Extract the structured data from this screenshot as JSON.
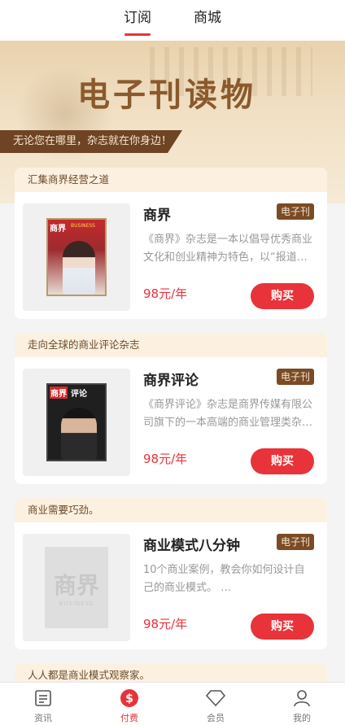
{
  "header": {
    "tabs": [
      {
        "label": "订阅",
        "active": true
      },
      {
        "label": "商城",
        "active": false
      }
    ]
  },
  "banner": {
    "title": "电子刊读物",
    "subtitle": "无论您在哪里，杂志就在你身边！"
  },
  "products": [
    {
      "slogan": "汇集商界经营之道",
      "name": "商界",
      "badge": "电子刊",
      "description": "《商界》杂志是一本以倡导优秀商业文化和创业精神为特色，以“报道…",
      "price": "98元/年",
      "buy_label": "购买",
      "cover": {
        "logo": "商界",
        "sub": "BUSINESS"
      }
    },
    {
      "slogan": "走向全球的商业评论杂志",
      "name": "商界评论",
      "badge": "电子刊",
      "description": "《商界评论》杂志是商界传媒有限公司旗下的一本高端的商业管理类杂…",
      "price": "98元/年",
      "buy_label": "购买",
      "cover": {
        "logo": "商界",
        "sub": "评论"
      }
    },
    {
      "slogan": "商业需要巧劲。",
      "name": "商业模式八分钟",
      "badge": "电子刊",
      "description": "10个商业案例，教会你如何设计自己的商业模式。 …",
      "price": "98元/年",
      "buy_label": "购买",
      "cover": {
        "logo": "商界",
        "sub": "BUSINESS"
      }
    },
    {
      "slogan": "人人都是商业模式观察家。"
    }
  ],
  "tabbar": [
    {
      "label": "资讯",
      "icon": "news-icon",
      "active": false
    },
    {
      "label": "付费",
      "icon": "paid-icon",
      "active": true
    },
    {
      "label": "会员",
      "icon": "diamond-icon",
      "active": false
    },
    {
      "label": "我的",
      "icon": "user-icon",
      "active": false
    }
  ],
  "colors": {
    "accent": "#e8333a",
    "brown": "#7a4b25",
    "banner": "#f1e0c4"
  }
}
